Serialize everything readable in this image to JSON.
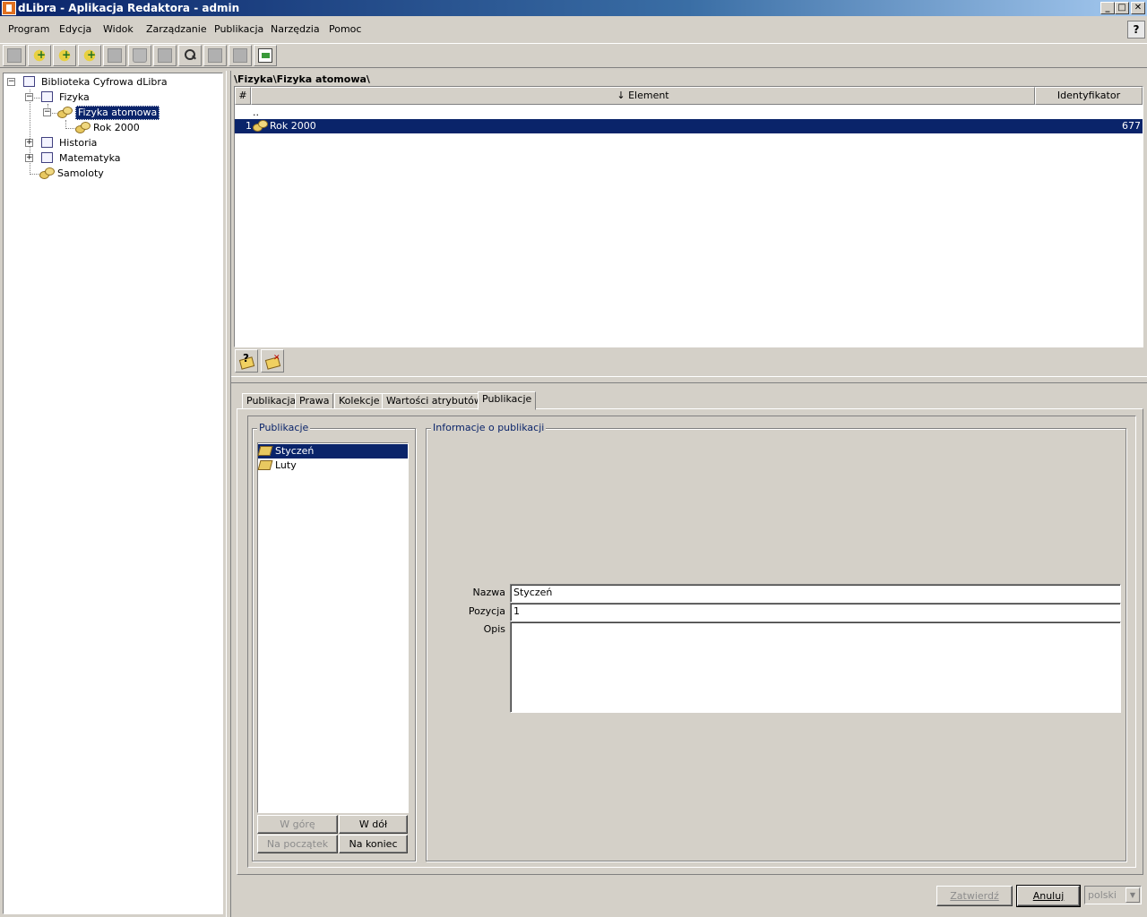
{
  "window": {
    "title": "dLibra - Aplikacja Redaktora - admin",
    "minimize_glyph": "_",
    "maximize_glyph": "□",
    "close_glyph": "✕"
  },
  "menu": [
    "Program",
    "Edycja",
    "Widok",
    "Zarządzanie",
    "Publikacja",
    "Narzędzia",
    "Pomoc"
  ],
  "help_glyph": "?",
  "toolbar": {
    "buttons": [
      "page-icon",
      "add-folder-icon",
      "add-collection-icon",
      "add-publication-icon",
      "page-icon",
      "trash-icon",
      "page-search-icon",
      "search-icon",
      "page-icon",
      "page-icon",
      "page-icon",
      "monitor-icon"
    ]
  },
  "tree": {
    "root": "Biblioteka Cyfrowa dLibra",
    "items": [
      {
        "label": "Fizyka"
      },
      {
        "label": "Fizyka atomowa"
      },
      {
        "label": "Rok 2000"
      },
      {
        "label": "Historia"
      },
      {
        "label": "Matematyka"
      },
      {
        "label": "Samoloty"
      }
    ],
    "expander_open": "−",
    "expander_closed": "+"
  },
  "path": "\\Fizyka\\Fizyka atomowa\\",
  "table": {
    "columns": {
      "num": "#",
      "element": "Element",
      "id": "Identyfikator"
    },
    "sort_glyph": "↓",
    "parent_row": "..",
    "rows": [
      {
        "num": "1",
        "element": "Rok 2000",
        "id": "677"
      }
    ]
  },
  "tabs": [
    "Publikacja",
    "Prawa",
    "Kolekcje",
    "Wartości atrybutów",
    "Publikacje"
  ],
  "publications_panel": {
    "title": "Publikacje",
    "items": [
      "Styczeń",
      "Luty"
    ],
    "buttons": {
      "up": "W górę",
      "down": "W dół",
      "top": "Na początek",
      "bottom": "Na koniec"
    }
  },
  "info_panel": {
    "title": "Informacje o publikacji",
    "name_label": "Nazwa",
    "name_value": "Styczeń",
    "position_label": "Pozycja",
    "position_value": "1",
    "desc_label": "Opis",
    "desc_value": ""
  },
  "footer": {
    "confirm": "Zatwierdź",
    "cancel": "Anuluj",
    "language": "polski",
    "dropdown_glyph": "▼"
  },
  "colors": {
    "selection": "#0a246a",
    "face": "#d4d0c8",
    "disabled_text": "#8c8c8c"
  }
}
